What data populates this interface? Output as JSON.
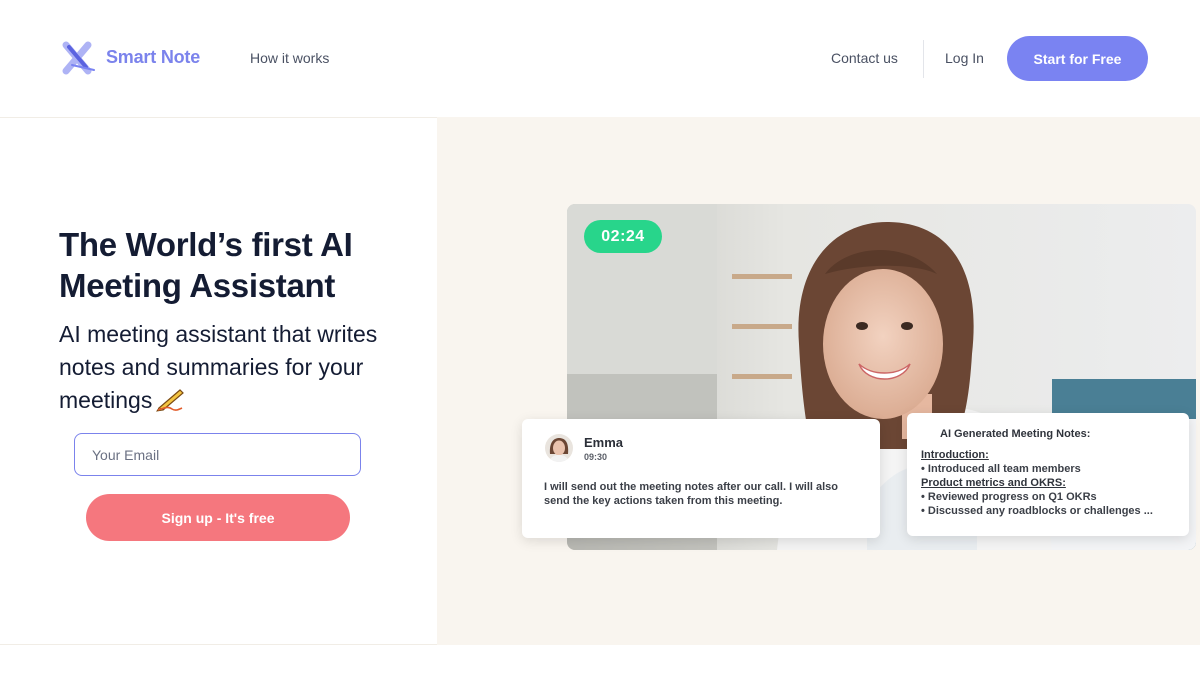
{
  "header": {
    "brand": "Smart Note",
    "nav": {
      "how_it_works": "How it works",
      "contact": "Contact us",
      "login": "Log In"
    },
    "cta": "Start for Free"
  },
  "hero": {
    "title": "The World’s first AI Meeting Assistant",
    "subtitle": "AI meeting assistant that writes notes and summaries for your meetings",
    "email_placeholder": "Your Email",
    "signup_label": "Sign up - It's free"
  },
  "video": {
    "timer": "02:24",
    "chat": {
      "name": "Emma",
      "time": "09:30",
      "message": "I will send out the meeting notes after our call. I will also send the key actions taken from this meeting."
    },
    "notes": {
      "title": "AI Generated Meeting Notes:",
      "sections": [
        {
          "heading": "Introduction:",
          "items": [
            "Introduced all team members"
          ]
        },
        {
          "heading": "Product metrics and OKRS:",
          "items": [
            "Reviewed progress on Q1 OKRs",
            "Discussed any roadblocks or challenges ..."
          ]
        }
      ]
    }
  },
  "colors": {
    "brand": "#7a83f2",
    "signup": "#f5777e",
    "timer": "#28d58b",
    "hero_right_bg": "#f9f5ef"
  },
  "icons": [
    "smart-note-logo-icon",
    "writing-hand-icon",
    "emma-avatar"
  ]
}
